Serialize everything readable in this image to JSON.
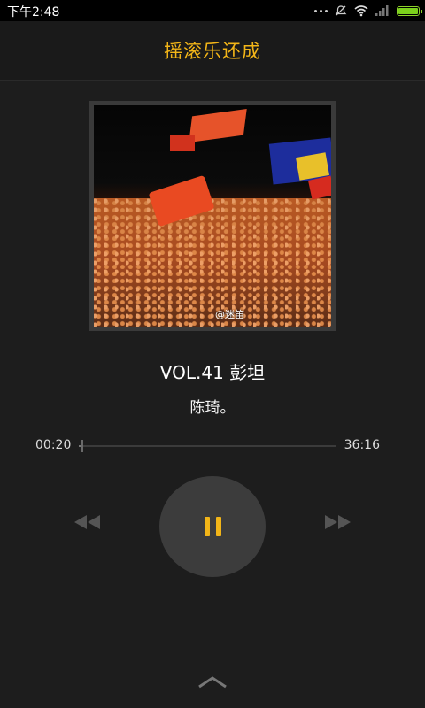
{
  "status_bar": {
    "time": "下午2:48"
  },
  "header": {
    "title": "摇滚乐还成"
  },
  "album_art": {
    "watermark": "@迷笛"
  },
  "track": {
    "title": "VOL.41 彭坦",
    "artist": "陈琦。"
  },
  "progress": {
    "elapsed": "00:20",
    "total": "36:16",
    "fraction": 0.009
  },
  "controls": {
    "play_state": "playing"
  },
  "colors": {
    "accent": "#f2b518",
    "background": "#1d1d1d"
  },
  "icons": [
    "signal-dots-icon",
    "mute-icon",
    "wifi-icon",
    "signal-bars-icon",
    "battery-icon",
    "rewind-icon",
    "pause-icon",
    "fast-forward-icon",
    "chevron-up-icon"
  ]
}
